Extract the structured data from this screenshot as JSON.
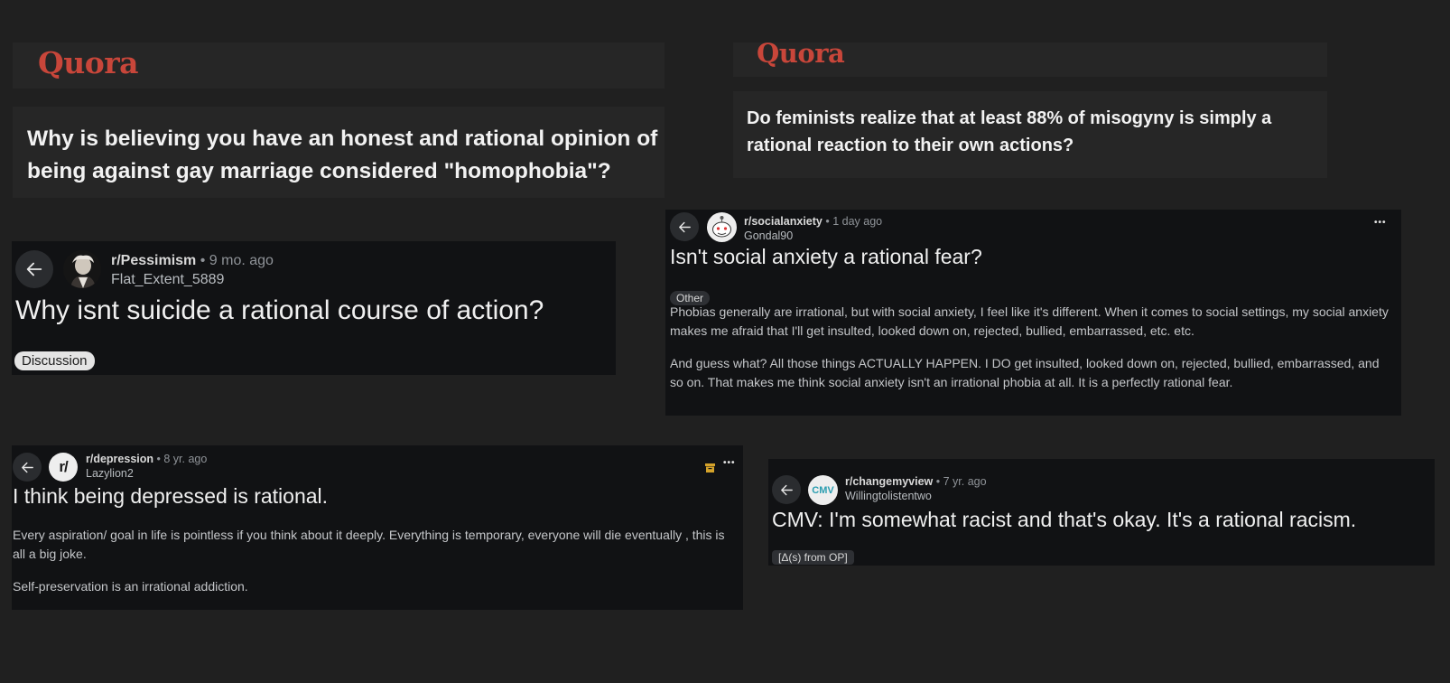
{
  "quora1": {
    "logo": "Quora",
    "question": "Why is believing you have an honest and rational opinion of being against gay marriage considered \"homophobia\"?"
  },
  "quora2": {
    "logo": "Quora",
    "question": "Do feminists realize that at least 88% of misogyny is simply a rational reaction to their own actions?"
  },
  "pessimism": {
    "subreddit": "r/Pessimism",
    "time": "• 9 mo. ago",
    "user": "Flat_Extent_5889",
    "title": "Why isnt suicide a rational course of action?",
    "flair": "Discussion"
  },
  "socialanxiety": {
    "subreddit": "r/socialanxiety",
    "time": "• 1 day ago",
    "user": "Gondal90",
    "title": "Isn't social anxiety a rational fear?",
    "flair": "Other",
    "para1": "Phobias generally are irrational, but with social anxiety, I feel like it's different. When it comes to social settings, my social anxiety makes me afraid that I'll get insulted, looked down on, rejected, bullied, embarrassed, etc. etc.",
    "para2": "And guess what? All those things ACTUALLY HAPPEN. I DO get insulted, looked down on, rejected, bullied, embarrassed, and so on. That makes me think social anxiety isn't an irrational phobia at all. It is a perfectly rational fear.",
    "more": "•••"
  },
  "depression": {
    "subreddit": "r/depression",
    "time": "• 8 yr. ago",
    "user": "Lazylion2",
    "avatar_text": "r/",
    "title": "I think being depressed is rational.",
    "para1": "Every aspiration/ goal in life is pointless if you think about it deeply. Everything is temporary, everyone will die eventually , this is all a big joke.",
    "para2": "Self-preservation is an irrational addiction.",
    "more": "•••"
  },
  "changemyview": {
    "subreddit": "r/changemyview",
    "time": "• 7 yr. ago",
    "user": "Willingtolistentwo",
    "avatar_text": "CMV",
    "title": "CMV: I'm somewhat racist and that's okay. It's a rational racism.",
    "flair": "[Δ(s) from OP]"
  },
  "icons": {
    "back": "arrow-left-icon",
    "more": "more-horizontal-icon",
    "archive": "archive-icon"
  },
  "colors": {
    "quora_red": "#c8463a",
    "reddit_card": "#111214",
    "quora_card": "#262626",
    "archive_yellow": "#d4a22a"
  }
}
